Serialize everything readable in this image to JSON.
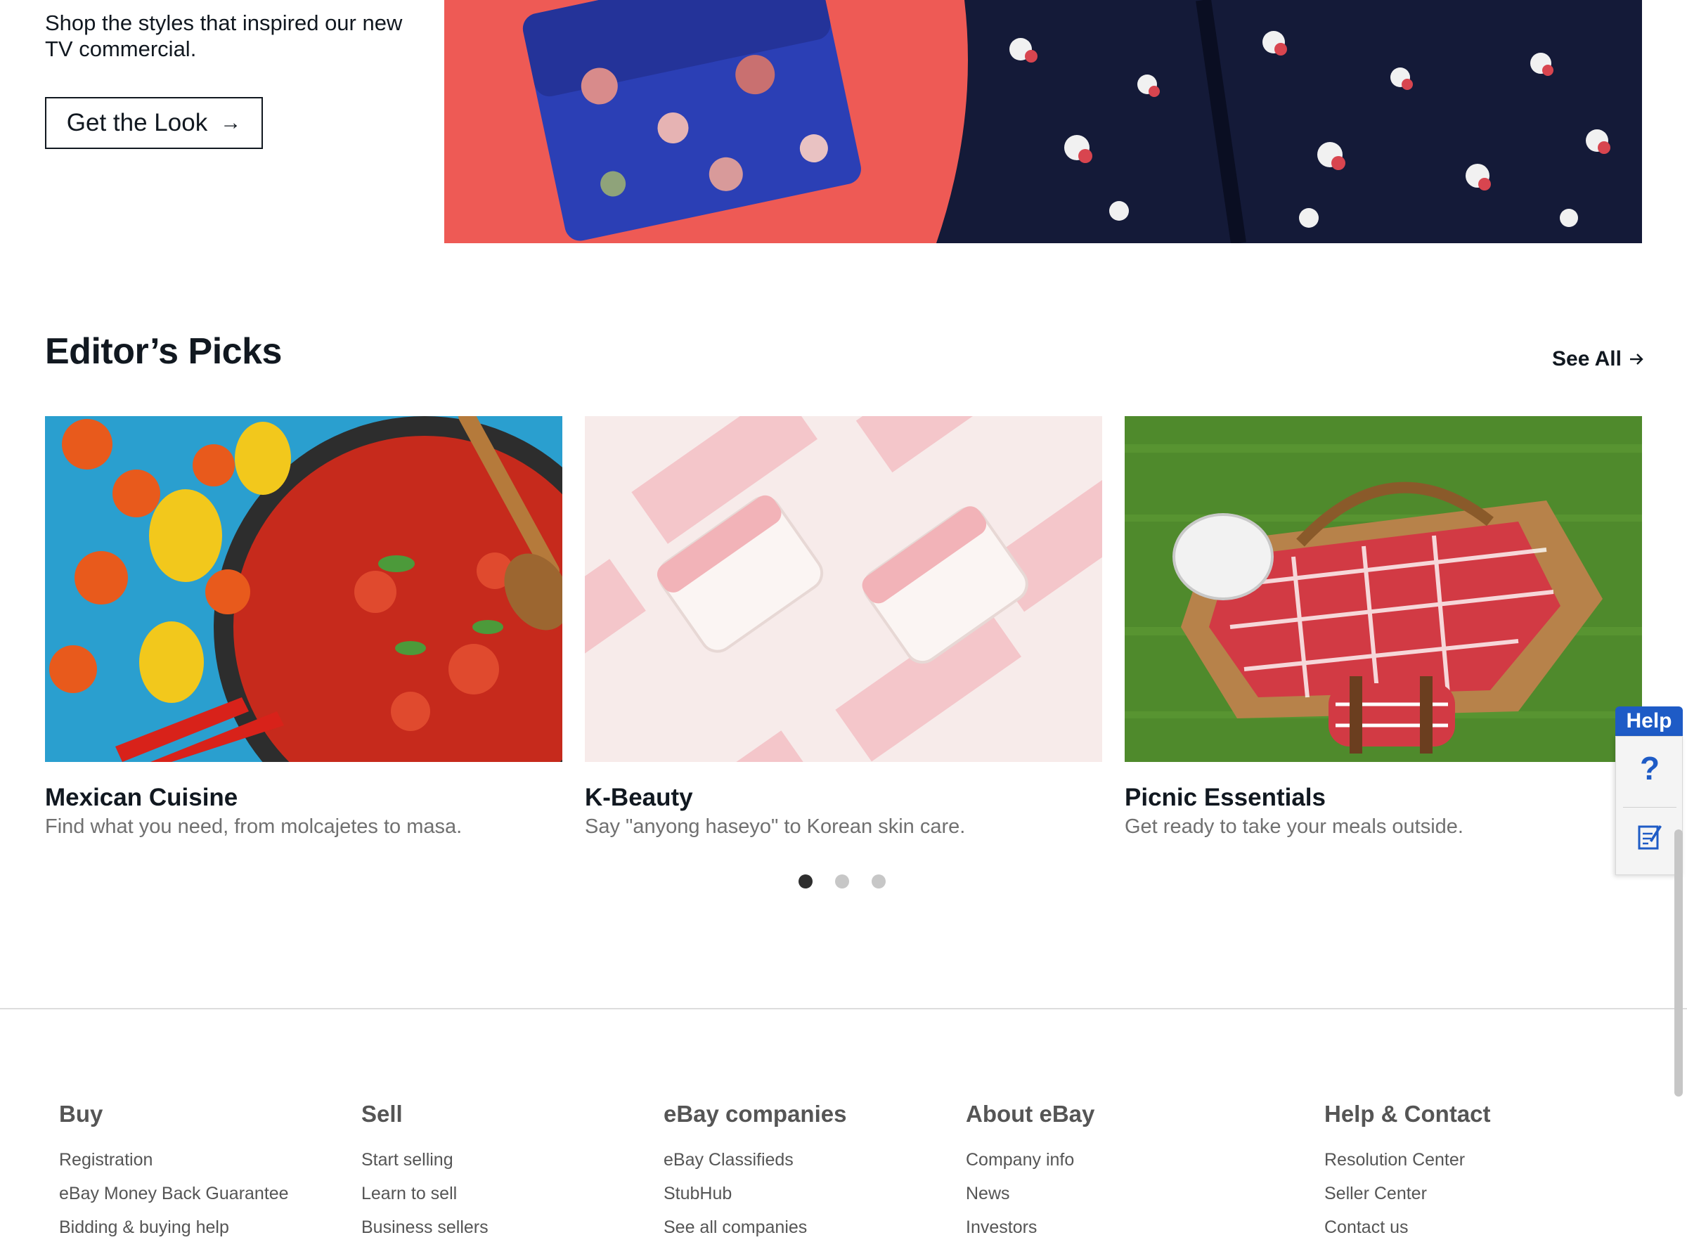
{
  "hero": {
    "text": "Shop the styles that inspired our new TV commercial.",
    "cta_label": "Get the Look",
    "cta_arrow": "→"
  },
  "editors_picks": {
    "title": "Editor’s Picks",
    "see_all_label": "See All",
    "cards": [
      {
        "title": "Mexican Cuisine",
        "subtitle": "Find what you need, from molcajetes to masa."
      },
      {
        "title": "K-Beauty",
        "subtitle": "Say \"anyong haseyo\" to Korean skin care."
      },
      {
        "title": "Picnic Essentials",
        "subtitle": "Get ready to take your meals outside."
      }
    ],
    "carousel": {
      "pages": 3,
      "active_page": 1
    }
  },
  "footer": {
    "columns": [
      {
        "heading": "Buy",
        "links": [
          "Registration",
          "eBay Money Back Guarantee",
          "Bidding & buying help"
        ]
      },
      {
        "heading": "Sell",
        "links": [
          "Start selling",
          "Learn to sell",
          "Business sellers"
        ]
      },
      {
        "heading": "eBay companies",
        "links": [
          "eBay Classifieds",
          "StubHub",
          "See all companies"
        ]
      },
      {
        "heading": "About eBay",
        "links": [
          "Company info",
          "News",
          "Investors"
        ]
      },
      {
        "heading": "Help & Contact",
        "links": [
          "Resolution Center",
          "Seller Center",
          "Contact us"
        ]
      }
    ]
  },
  "help_widget": {
    "tab_label": "Help",
    "question_glyph": "?",
    "icons": [
      "question-icon",
      "feedback-icon"
    ]
  },
  "colors": {
    "hero_bg": "#ee5a55",
    "text_primary": "#111820",
    "text_secondary": "#707070",
    "footer_text": "#555555",
    "help_blue": "#1e5bc6"
  }
}
